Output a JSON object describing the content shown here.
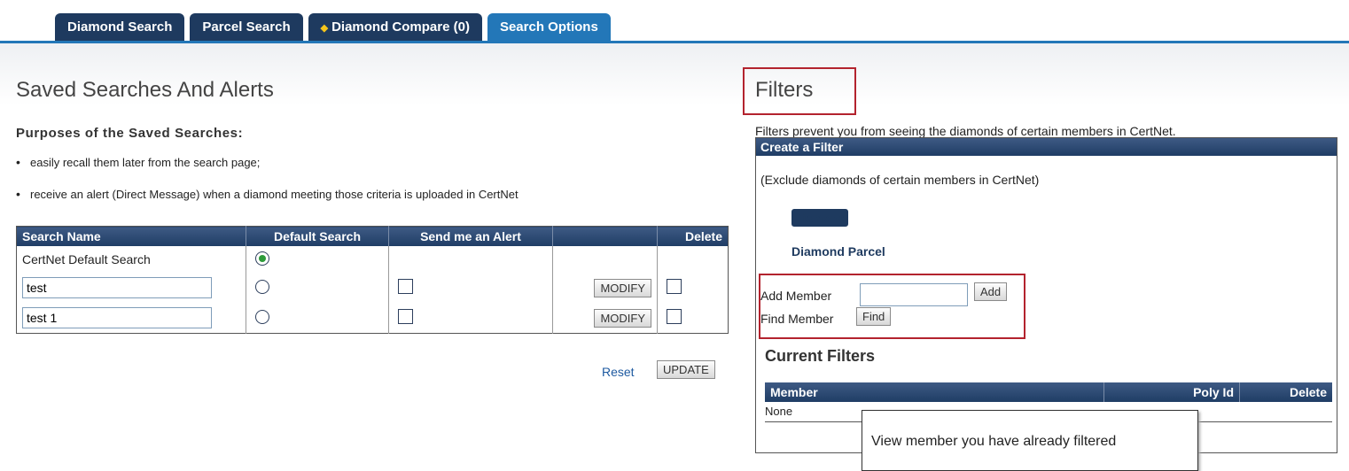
{
  "tabs": [
    {
      "label": "Diamond Search"
    },
    {
      "label": "Parcel Search"
    },
    {
      "label": "Diamond Compare (0)",
      "icon": "diamond-icon"
    },
    {
      "label": "Search Options"
    }
  ],
  "saved": {
    "title": "Saved Searches And Alerts",
    "purposes_heading": "Purposes of the Saved Searches:",
    "bullets": [
      "easily recall them later from the search page;",
      "receive an alert (Direct Message) when a diamond meeting those criteria is uploaded in CertNet"
    ],
    "columns": [
      "Search Name",
      "Default Search",
      "Send me an Alert",
      "",
      "Delete"
    ],
    "rows": [
      {
        "name": "CertNet Default Search",
        "default": true
      },
      {
        "name": "test",
        "default": false,
        "alert": false,
        "modify": "MODIFY",
        "delete": false
      },
      {
        "name": "test 1",
        "default": false,
        "alert": false,
        "modify": "MODIFY",
        "delete": false
      }
    ],
    "reset_label": "Reset",
    "update_label": "UPDATE"
  },
  "filters": {
    "title": "Filters",
    "description": "Filters prevent you from seeing the diamonds of certain members in CertNet.",
    "panel_title": "Create a Filter",
    "subtext": "(Exclude diamonds of certain members in CertNet)",
    "option_diamond": "Diamond",
    "option_parcel": "Diamond Parcel",
    "add_member_label": "Add Member",
    "add_button": "Add",
    "find_member_label": "Find Member",
    "find_button": "Find",
    "current_title": "Current Filters",
    "columns": [
      "Member",
      "Poly Id",
      "Delete"
    ],
    "empty": "None",
    "tooltip": "View member you have already filtered"
  },
  "colors": {
    "tab_dark": "#1e3a5f",
    "tab_active": "#2377b8",
    "highlight_red": "#b3232e",
    "link_blue": "#1e5aa0"
  }
}
